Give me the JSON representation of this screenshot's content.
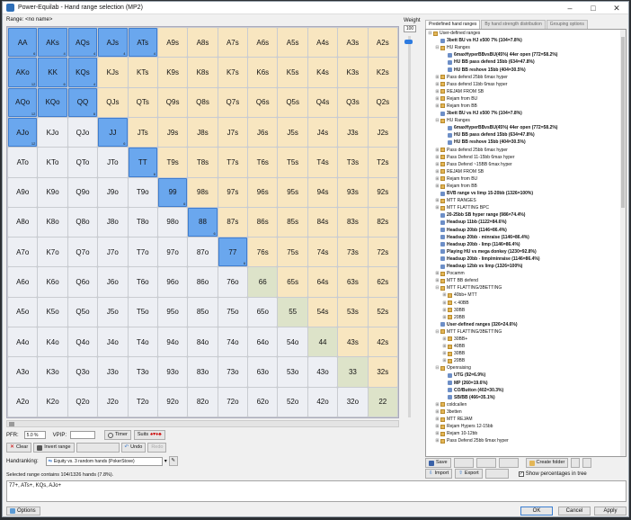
{
  "window": {
    "title": "Power-Equilab - Hand range selection (MP2)",
    "minimize": "–",
    "maximize": "□",
    "close": "✕"
  },
  "range_label": "Range: <no name>",
  "weight": {
    "label": "Weight",
    "value": "100"
  },
  "grid": [
    [
      "AA",
      "AKs",
      "AQs",
      "AJs",
      "ATs",
      "A9s",
      "A8s",
      "A7s",
      "A6s",
      "A5s",
      "A4s",
      "A3s",
      "A2s"
    ],
    [
      "AKo",
      "KK",
      "KQs",
      "KJs",
      "KTs",
      "K9s",
      "K8s",
      "K7s",
      "K6s",
      "K5s",
      "K4s",
      "K3s",
      "K2s"
    ],
    [
      "AQo",
      "KQo",
      "QQ",
      "QJs",
      "QTs",
      "Q9s",
      "Q8s",
      "Q7s",
      "Q6s",
      "Q5s",
      "Q4s",
      "Q3s",
      "Q2s"
    ],
    [
      "AJo",
      "KJo",
      "QJo",
      "JJ",
      "JTs",
      "J9s",
      "J8s",
      "J7s",
      "J6s",
      "J5s",
      "J4s",
      "J3s",
      "J2s"
    ],
    [
      "ATo",
      "KTo",
      "QTo",
      "JTo",
      "TT",
      "T9s",
      "T8s",
      "T7s",
      "T6s",
      "T5s",
      "T4s",
      "T3s",
      "T2s"
    ],
    [
      "A9o",
      "K9o",
      "Q9o",
      "J9o",
      "T9o",
      "99",
      "98s",
      "97s",
      "96s",
      "95s",
      "94s",
      "93s",
      "92s"
    ],
    [
      "A8o",
      "K8o",
      "Q8o",
      "J8o",
      "T8o",
      "98o",
      "88",
      "87s",
      "86s",
      "85s",
      "84s",
      "83s",
      "82s"
    ],
    [
      "A7o",
      "K7o",
      "Q7o",
      "J7o",
      "T7o",
      "97o",
      "87o",
      "77",
      "76s",
      "75s",
      "74s",
      "73s",
      "72s"
    ],
    [
      "A6o",
      "K6o",
      "Q6o",
      "J6o",
      "T6o",
      "96o",
      "86o",
      "76o",
      "66",
      "65s",
      "64s",
      "63s",
      "62s"
    ],
    [
      "A5o",
      "K5o",
      "Q5o",
      "J5o",
      "T5o",
      "95o",
      "85o",
      "75o",
      "65o",
      "55",
      "54s",
      "53s",
      "52s"
    ],
    [
      "A4o",
      "K4o",
      "Q4o",
      "J4o",
      "T4o",
      "94o",
      "84o",
      "74o",
      "64o",
      "54o",
      "44",
      "43s",
      "42s"
    ],
    [
      "A3o",
      "K3o",
      "Q3o",
      "J3o",
      "T3o",
      "93o",
      "83o",
      "73o",
      "63o",
      "53o",
      "43o",
      "33",
      "32s"
    ],
    [
      "A2o",
      "K2o",
      "Q2o",
      "J2o",
      "T2o",
      "92o",
      "82o",
      "72o",
      "62o",
      "52o",
      "42o",
      "32o",
      "22"
    ]
  ],
  "selected": [
    "AA",
    "AKs",
    "AQs",
    "AJs",
    "ATs",
    "AKo",
    "KK",
    "KQs",
    "AQo",
    "KQo",
    "QQ",
    "AJo",
    "JJ",
    "TT",
    "99",
    "88",
    "77"
  ],
  "counts": {
    "AA": "6",
    "AKs": "4",
    "AQs": "4",
    "AJs": "4",
    "ATs": "4",
    "AKo": "12",
    "KK": "6",
    "KQs": "4",
    "AQo": "12",
    "KQo": "",
    "QQ": "6",
    "AJo": "12",
    "JJ": "6",
    "TT": "6",
    "99": "6",
    "88": "6",
    "77": "6"
  },
  "colors": {
    "selected": "#6aa7ee",
    "pair": "#dde3c9",
    "suited": "#f8e6c0",
    "offsuit": "#edeff4"
  },
  "controls": {
    "ppr_label": "PFR:",
    "ppr_value": "5.0 %",
    "vpip_label": "VPIP:",
    "vpip_value": "",
    "timer": "Timer",
    "suits": "Suits",
    "clear": "Clear",
    "invert": "Invert range",
    "undo": "Undo",
    "redo": "Redo",
    "dup": "",
    "handranking_label": "Handranking:",
    "handranking_value": "Equity vs. 3 random hands (PokerStove)"
  },
  "tabs": [
    "Predefined hand ranges",
    "By hand strength distribution",
    "Grouping options"
  ],
  "tree": [
    {
      "lvl": 0,
      "t": "f",
      "label": "User-defined ranges",
      "b": false,
      "exp": "-"
    },
    {
      "lvl": 1,
      "t": "r",
      "label": "3bett BU vs HJ x500 7% (104=7.8%)",
      "b": true
    },
    {
      "lvl": 1,
      "t": "f",
      "label": "HU Ranges",
      "b": false,
      "exp": "-"
    },
    {
      "lvl": 2,
      "t": "r",
      "label": "6maxHyperBBvsBU(45%) 44er open (772=58.2%)",
      "b": true
    },
    {
      "lvl": 2,
      "t": "r",
      "label": "HU BB pass defend 15bb (634=47.8%)",
      "b": true
    },
    {
      "lvl": 2,
      "t": "r",
      "label": "HU BB reshove 15bb (404=30.5%)",
      "b": true
    },
    {
      "lvl": 1,
      "t": "f",
      "label": "Pass defend 25bb 6max hyper",
      "b": false,
      "exp": "+"
    },
    {
      "lvl": 1,
      "t": "f",
      "label": "Pass defend 11bb 6max hyper",
      "b": false,
      "exp": "+"
    },
    {
      "lvl": 1,
      "t": "f",
      "label": "REJAM FROM SB",
      "b": false,
      "exp": "+"
    },
    {
      "lvl": 1,
      "t": "f",
      "label": "Rejam from BU",
      "b": false,
      "exp": "+"
    },
    {
      "lvl": 1,
      "t": "f",
      "label": "Rejam from BB",
      "b": false,
      "exp": "+"
    },
    {
      "lvl": 1,
      "t": "r",
      "label": "3bett BU vs HJ x500 7% (104=7.8%)",
      "b": true
    },
    {
      "lvl": 1,
      "t": "f",
      "label": "HU Ranges",
      "b": false,
      "exp": "-"
    },
    {
      "lvl": 2,
      "t": "r",
      "label": "6maxHyperBBvsBU(45%) 44er open (772=58.2%)",
      "b": true
    },
    {
      "lvl": 2,
      "t": "r",
      "label": "HU BB pass defend 15bb (634=47.8%)",
      "b": true
    },
    {
      "lvl": 2,
      "t": "r",
      "label": "HU BB reshove 15bb (404=30.5%)",
      "b": true
    },
    {
      "lvl": 1,
      "t": "f",
      "label": "Pass defend 25bb 6max hyper",
      "b": false,
      "exp": "+"
    },
    {
      "lvl": 1,
      "t": "f",
      "label": "Pass Defend 11-15bb 6max hyper",
      "b": false,
      "exp": "+"
    },
    {
      "lvl": 1,
      "t": "f",
      "label": "Pass Defend ~15BB 6max hyper",
      "b": false,
      "exp": "+"
    },
    {
      "lvl": 1,
      "t": "f",
      "label": "REJAM FROM SB",
      "b": false,
      "exp": "+"
    },
    {
      "lvl": 1,
      "t": "f",
      "label": "Rejam from BU",
      "b": false,
      "exp": "+"
    },
    {
      "lvl": 1,
      "t": "f",
      "label": "Rejam from BB",
      "b": false,
      "exp": "+"
    },
    {
      "lvl": 1,
      "t": "r",
      "label": "BVB range vs limp 15-20bb (1326=100%)",
      "b": true
    },
    {
      "lvl": 1,
      "t": "f",
      "label": "MTT RANGES",
      "b": false,
      "exp": "+"
    },
    {
      "lvl": 1,
      "t": "f",
      "label": "MTT FLATTING BPC",
      "b": false,
      "exp": "+"
    },
    {
      "lvl": 1,
      "t": "r",
      "label": "20-25bb SB hyper range (986=74.4%)",
      "b": true
    },
    {
      "lvl": 1,
      "t": "r",
      "label": "Headsup 11bb (1122=84.6%)",
      "b": true
    },
    {
      "lvl": 1,
      "t": "r",
      "label": "Headsup 20bb (1146=86.4%)",
      "b": true
    },
    {
      "lvl": 1,
      "t": "r",
      "label": "Headsup 20bb - minraise (1146=86.4%)",
      "b": true
    },
    {
      "lvl": 1,
      "t": "r",
      "label": "Headsup 20bb - limp (1146=86.4%)",
      "b": true
    },
    {
      "lvl": 1,
      "t": "r",
      "label": "Playing HU vs mega donkey (1230=92.8%)",
      "b": true
    },
    {
      "lvl": 1,
      "t": "r",
      "label": "Headsup 20bb - limp/minraise (1146=86.4%)",
      "b": true
    },
    {
      "lvl": 1,
      "t": "r",
      "label": "Headsup 12bb vs limp (1326=100%)",
      "b": true
    },
    {
      "lvl": 1,
      "t": "f",
      "label": "Pocamm",
      "b": false,
      "exp": "+"
    },
    {
      "lvl": 1,
      "t": "f",
      "label": "MTT BB defend",
      "b": false,
      "exp": "+"
    },
    {
      "lvl": 1,
      "t": "f",
      "label": "MTT FLATTING/3BETTING",
      "b": false,
      "exp": "-"
    },
    {
      "lvl": 2,
      "t": "f",
      "label": "40bb+ MTT",
      "b": false,
      "exp": "+"
    },
    {
      "lvl": 2,
      "t": "f",
      "label": "< 40BB",
      "b": false,
      "exp": "+"
    },
    {
      "lvl": 2,
      "t": "f",
      "label": "30BB",
      "b": false,
      "exp": "+"
    },
    {
      "lvl": 2,
      "t": "f",
      "label": "20BB",
      "b": false,
      "exp": "+"
    },
    {
      "lvl": 1,
      "t": "r",
      "label": "User-defined ranges (326=24.6%)",
      "b": true
    },
    {
      "lvl": 1,
      "t": "f",
      "label": "MTT FLATTING/3BETTING",
      "b": false,
      "exp": "-"
    },
    {
      "lvl": 2,
      "t": "f",
      "label": "30BB+",
      "b": false,
      "exp": "+"
    },
    {
      "lvl": 2,
      "t": "f",
      "label": "40BB",
      "b": false,
      "exp": "+"
    },
    {
      "lvl": 2,
      "t": "f",
      "label": "30BB",
      "b": false,
      "exp": "+"
    },
    {
      "lvl": 2,
      "t": "f",
      "label": "20BB",
      "b": false,
      "exp": "+"
    },
    {
      "lvl": 1,
      "t": "f",
      "label": "Openraising",
      "b": false,
      "exp": "-"
    },
    {
      "lvl": 2,
      "t": "r",
      "label": "UTG (92=6.9%)",
      "b": true
    },
    {
      "lvl": 2,
      "t": "r",
      "label": "MP (260=19.6%)",
      "b": true
    },
    {
      "lvl": 2,
      "t": "r",
      "label": "CO/Button (402=30.3%)",
      "b": true
    },
    {
      "lvl": 2,
      "t": "r",
      "label": "SB/BB (466=35.1%)",
      "b": true
    },
    {
      "lvl": 1,
      "t": "f",
      "label": "coldcallen",
      "b": false,
      "exp": "+"
    },
    {
      "lvl": 1,
      "t": "f",
      "label": "3betten",
      "b": false,
      "exp": "+"
    },
    {
      "lvl": 1,
      "t": "f",
      "label": "MTT REJAM",
      "b": false,
      "exp": "+"
    },
    {
      "lvl": 1,
      "t": "f",
      "label": "Rejam Hypers 12-15bb",
      "b": false,
      "exp": "+"
    },
    {
      "lvl": 1,
      "t": "f",
      "label": "Rejam 10-12bb",
      "b": false,
      "exp": "+"
    },
    {
      "lvl": 1,
      "t": "f",
      "label": "Pass Defend 25bb 6max hyper",
      "b": false,
      "exp": "+"
    }
  ],
  "tree_buttons": {
    "save": "Save",
    "import": "Import",
    "export": "Export",
    "create_folder": "Create folder",
    "show_pct": "Show percentages in tree"
  },
  "status_text": "Selected range contains 104/1326 hands (7.8%).",
  "range_text": "77+, ATs+, KQs, AJo+",
  "bottom": {
    "options": "Options",
    "ok": "OK",
    "cancel": "Cancel",
    "apply": "Apply"
  }
}
